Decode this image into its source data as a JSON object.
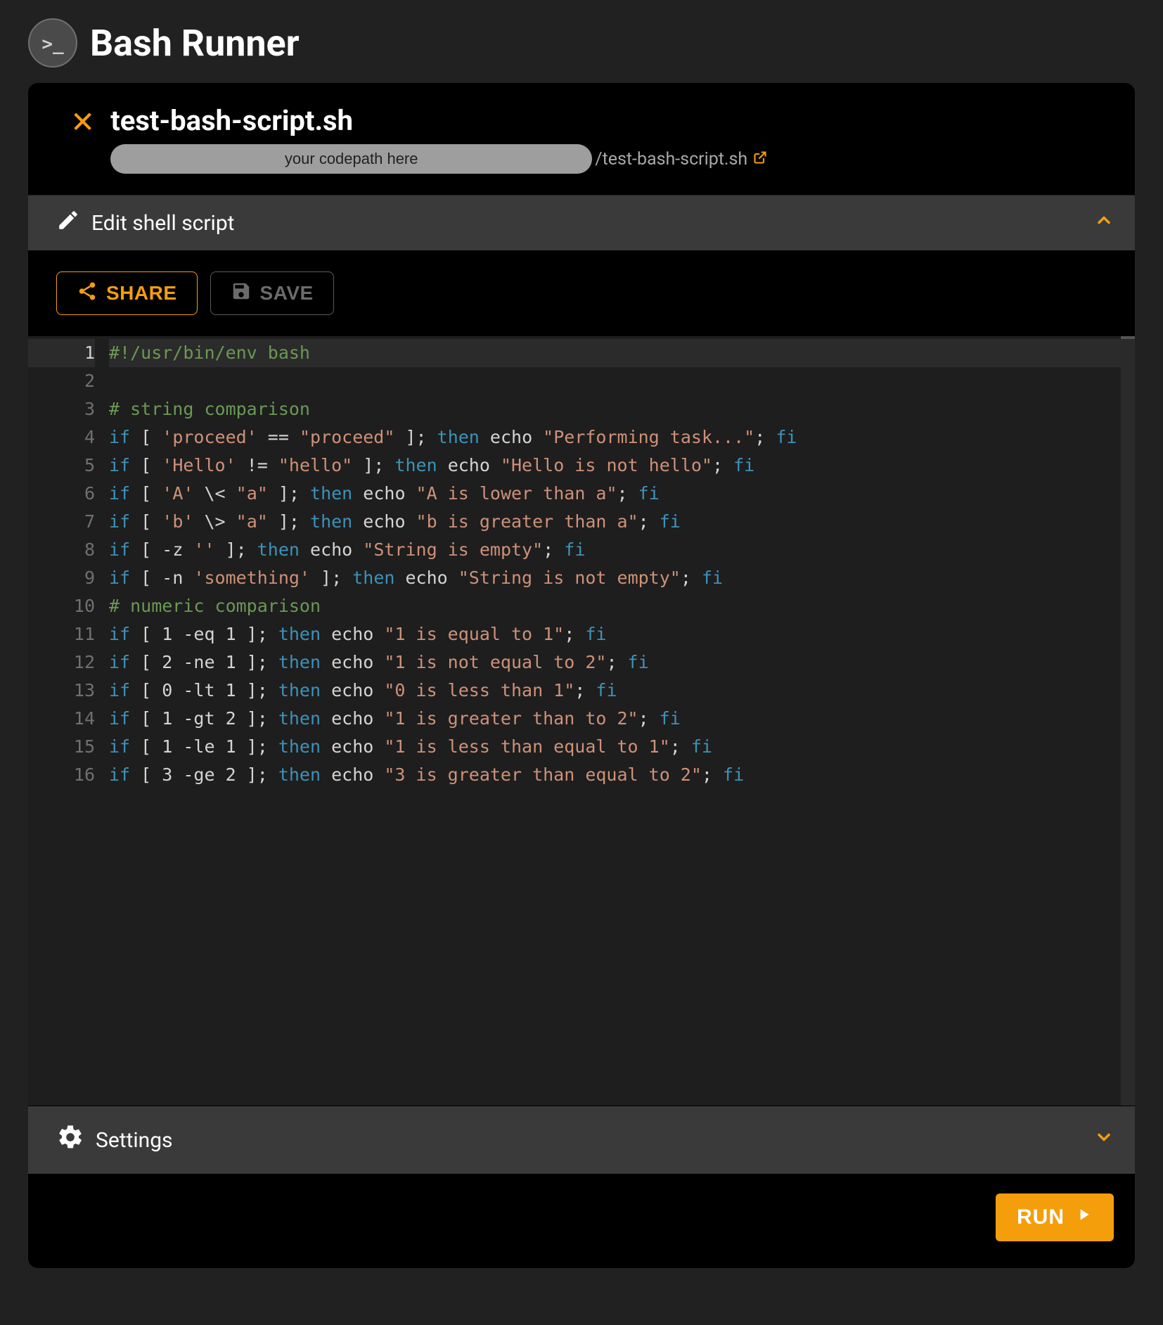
{
  "app": {
    "title": "Bash Runner"
  },
  "file": {
    "name": "test-bash-script.sh",
    "codepath_placeholder": "your codepath here",
    "path_suffix": "/test-bash-script.sh"
  },
  "section_edit": {
    "label": "Edit shell script"
  },
  "actions": {
    "share": "SHARE",
    "save": "SAVE"
  },
  "section_settings": {
    "label": "Settings"
  },
  "run": {
    "label": "RUN"
  },
  "code_lines": [
    [
      {
        "c": "green",
        "t": "#!/usr/bin/env bash"
      }
    ],
    [
      {
        "c": "punc",
        "t": ""
      }
    ],
    [
      {
        "c": "green",
        "t": "# string comparison"
      }
    ],
    [
      {
        "c": "cyan",
        "t": "if"
      },
      {
        "c": "punc",
        "t": " [ "
      },
      {
        "c": "str",
        "t": "'proceed'"
      },
      {
        "c": "punc",
        "t": " == "
      },
      {
        "c": "str",
        "t": "\"proceed\""
      },
      {
        "c": "punc",
        "t": " ]; "
      },
      {
        "c": "cyan",
        "t": "then"
      },
      {
        "c": "punc",
        "t": " echo "
      },
      {
        "c": "str",
        "t": "\"Performing task...\""
      },
      {
        "c": "punc",
        "t": "; "
      },
      {
        "c": "cyan",
        "t": "fi"
      }
    ],
    [
      {
        "c": "cyan",
        "t": "if"
      },
      {
        "c": "punc",
        "t": " [ "
      },
      {
        "c": "str",
        "t": "'Hello'"
      },
      {
        "c": "punc",
        "t": " != "
      },
      {
        "c": "str",
        "t": "\"hello\""
      },
      {
        "c": "punc",
        "t": " ]; "
      },
      {
        "c": "cyan",
        "t": "then"
      },
      {
        "c": "punc",
        "t": " echo "
      },
      {
        "c": "str",
        "t": "\"Hello is not hello\""
      },
      {
        "c": "punc",
        "t": "; "
      },
      {
        "c": "cyan",
        "t": "fi"
      }
    ],
    [
      {
        "c": "cyan",
        "t": "if"
      },
      {
        "c": "punc",
        "t": " [ "
      },
      {
        "c": "str",
        "t": "'A'"
      },
      {
        "c": "punc",
        "t": " \\< "
      },
      {
        "c": "str",
        "t": "\"a\""
      },
      {
        "c": "punc",
        "t": " ]; "
      },
      {
        "c": "cyan",
        "t": "then"
      },
      {
        "c": "punc",
        "t": " echo "
      },
      {
        "c": "str",
        "t": "\"A is lower than a\""
      },
      {
        "c": "punc",
        "t": "; "
      },
      {
        "c": "cyan",
        "t": "fi"
      }
    ],
    [
      {
        "c": "cyan",
        "t": "if"
      },
      {
        "c": "punc",
        "t": " [ "
      },
      {
        "c": "str",
        "t": "'b'"
      },
      {
        "c": "punc",
        "t": " \\> "
      },
      {
        "c": "str",
        "t": "\"a\""
      },
      {
        "c": "punc",
        "t": " ]; "
      },
      {
        "c": "cyan",
        "t": "then"
      },
      {
        "c": "punc",
        "t": " echo "
      },
      {
        "c": "str",
        "t": "\"b is greater than a\""
      },
      {
        "c": "punc",
        "t": "; "
      },
      {
        "c": "cyan",
        "t": "fi"
      }
    ],
    [
      {
        "c": "cyan",
        "t": "if"
      },
      {
        "c": "punc",
        "t": " [ -z "
      },
      {
        "c": "str",
        "t": "''"
      },
      {
        "c": "punc",
        "t": " ]; "
      },
      {
        "c": "cyan",
        "t": "then"
      },
      {
        "c": "punc",
        "t": " echo "
      },
      {
        "c": "str",
        "t": "\"String is empty\""
      },
      {
        "c": "punc",
        "t": "; "
      },
      {
        "c": "cyan",
        "t": "fi"
      }
    ],
    [
      {
        "c": "cyan",
        "t": "if"
      },
      {
        "c": "punc",
        "t": " [ -n "
      },
      {
        "c": "str",
        "t": "'something'"
      },
      {
        "c": "punc",
        "t": " ]; "
      },
      {
        "c": "cyan",
        "t": "then"
      },
      {
        "c": "punc",
        "t": " echo "
      },
      {
        "c": "str",
        "t": "\"String is not empty\""
      },
      {
        "c": "punc",
        "t": "; "
      },
      {
        "c": "cyan",
        "t": "fi"
      }
    ],
    [
      {
        "c": "green",
        "t": "# numeric comparison"
      }
    ],
    [
      {
        "c": "cyan",
        "t": "if"
      },
      {
        "c": "punc",
        "t": " [ 1 -eq 1 ]; "
      },
      {
        "c": "cyan",
        "t": "then"
      },
      {
        "c": "punc",
        "t": " echo "
      },
      {
        "c": "str",
        "t": "\"1 is equal to 1\""
      },
      {
        "c": "punc",
        "t": "; "
      },
      {
        "c": "cyan",
        "t": "fi"
      }
    ],
    [
      {
        "c": "cyan",
        "t": "if"
      },
      {
        "c": "punc",
        "t": " [ 2 -ne 1 ]; "
      },
      {
        "c": "cyan",
        "t": "then"
      },
      {
        "c": "punc",
        "t": " echo "
      },
      {
        "c": "str",
        "t": "\"1 is not equal to 2\""
      },
      {
        "c": "punc",
        "t": "; "
      },
      {
        "c": "cyan",
        "t": "fi"
      }
    ],
    [
      {
        "c": "cyan",
        "t": "if"
      },
      {
        "c": "punc",
        "t": " [ 0 -lt 1 ]; "
      },
      {
        "c": "cyan",
        "t": "then"
      },
      {
        "c": "punc",
        "t": " echo "
      },
      {
        "c": "str",
        "t": "\"0 is less than 1\""
      },
      {
        "c": "punc",
        "t": "; "
      },
      {
        "c": "cyan",
        "t": "fi"
      }
    ],
    [
      {
        "c": "cyan",
        "t": "if"
      },
      {
        "c": "punc",
        "t": " [ 1 -gt 2 ]; "
      },
      {
        "c": "cyan",
        "t": "then"
      },
      {
        "c": "punc",
        "t": " echo "
      },
      {
        "c": "str",
        "t": "\"1 is greater than to 2\""
      },
      {
        "c": "punc",
        "t": "; "
      },
      {
        "c": "cyan",
        "t": "fi"
      }
    ],
    [
      {
        "c": "cyan",
        "t": "if"
      },
      {
        "c": "punc",
        "t": " [ 1 -le 1 ]; "
      },
      {
        "c": "cyan",
        "t": "then"
      },
      {
        "c": "punc",
        "t": " echo "
      },
      {
        "c": "str",
        "t": "\"1 is less than equal to 1\""
      },
      {
        "c": "punc",
        "t": "; "
      },
      {
        "c": "cyan",
        "t": "fi"
      }
    ],
    [
      {
        "c": "cyan",
        "t": "if"
      },
      {
        "c": "punc",
        "t": " [ 3 -ge 2 ]; "
      },
      {
        "c": "cyan",
        "t": "then"
      },
      {
        "c": "punc",
        "t": " echo "
      },
      {
        "c": "str",
        "t": "\"3 is greater than equal to 2\""
      },
      {
        "c": "punc",
        "t": "; "
      },
      {
        "c": "cyan",
        "t": "fi"
      }
    ]
  ]
}
